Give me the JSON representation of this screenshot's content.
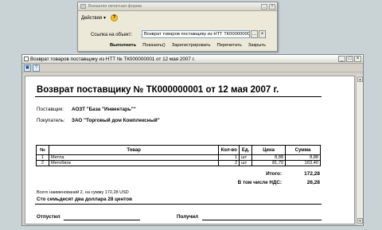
{
  "dialog": {
    "title": "Внешняя печатная форма",
    "menu_actions": "Действия",
    "object_label": "Ссылка на объект:",
    "object_value": "Возврат товаров поставщику из НТТ ТК00000000",
    "buttons": {
      "run": "Выполнить",
      "show": "Показать()",
      "register": "Зарегистрировать",
      "reread": "Перечитать",
      "close": "Закрыть"
    }
  },
  "window": {
    "title": "Возврат товаров поставщику из НТТ № ТК000000001 от 12 мая 2007 г."
  },
  "document": {
    "heading": "Возврат поставщику № ТК000000001 от 12 мая 2007 г.",
    "supplier_label": "Поставщик:",
    "supplier_value": "АОЗТ \"База \"Инвентарь\"\"",
    "buyer_label": "Покупатель:",
    "buyer_value": "ЗАО \"Торговый дом Комплексный\"",
    "columns": [
      "№",
      "Товар",
      "Кол-во",
      "Ед.",
      "Цена",
      "Сумма"
    ],
    "rows": [
      [
        "1",
        "Метла",
        "1",
        "шт",
        "8,88",
        "8,88"
      ],
      [
        "2",
        "Метобяок",
        "2",
        "шт",
        "81,70",
        "163,40"
      ]
    ],
    "total_label": "Итого:",
    "total_value": "172,28",
    "vat_label": "В том числе НДС:",
    "vat_value": "26,28",
    "items_note": "Всего наименований 2, на сумму 172,28 USD",
    "amount_words": "Сто семьдесят два доллара 28 центов",
    "released_label": "Отпустил",
    "received_label": "Получил"
  }
}
